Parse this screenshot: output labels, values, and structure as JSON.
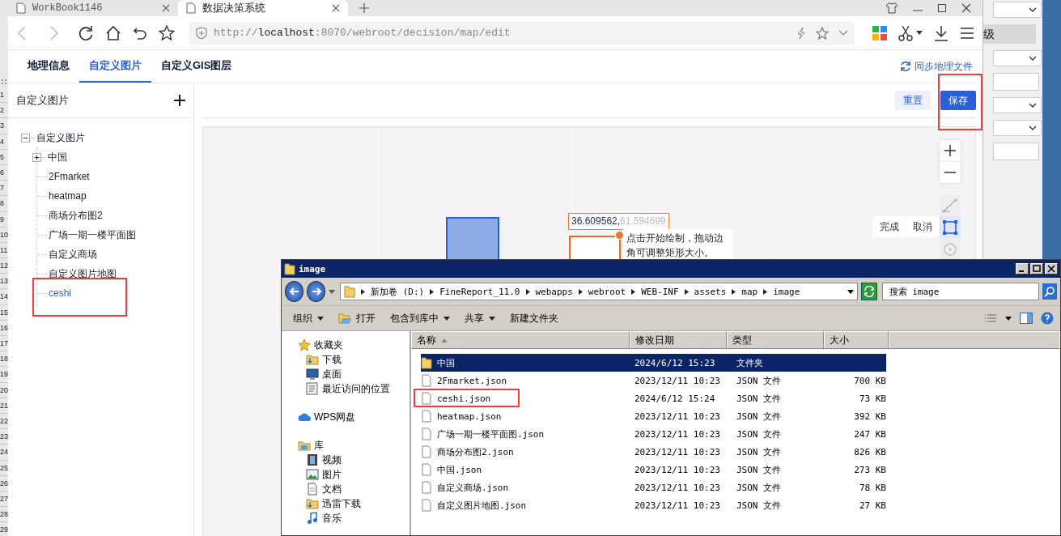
{
  "spreadsheet_background": {
    "row_numbers": [
      "1",
      "2",
      "3",
      "4",
      "5",
      "6",
      "7",
      "8",
      "9",
      "10",
      "11",
      "12",
      "13",
      "14",
      "15",
      "16",
      "17",
      "18",
      "19",
      "20",
      "21",
      "22",
      "23",
      "24",
      "25",
      "26",
      "27",
      "28",
      "29"
    ],
    "panel_label": "级"
  },
  "browser": {
    "tabs": [
      {
        "title": "WorkBook1146",
        "selected": false
      },
      {
        "title": "数据决策系统",
        "selected": true
      }
    ],
    "address": "http://**localhost**:8070/webroot/decision/map/edit",
    "app": {
      "tabs": [
        {
          "label": "地理信息",
          "selected": false
        },
        {
          "label": "自定义图片",
          "selected": true
        },
        {
          "label": "自定义GIS图层",
          "selected": false
        }
      ],
      "sync_link": "同步地理文件",
      "sidebar": {
        "title": "自定义图片",
        "tree": [
          {
            "label": "自定义图片",
            "expanded": true,
            "selected": false,
            "children": [
              {
                "label": "中国",
                "expanded": false,
                "selected": false
              },
              {
                "label": "2Fmarket",
                "selected": false
              },
              {
                "label": "heatmap",
                "selected": false
              },
              {
                "label": "商场分布图2",
                "selected": false
              },
              {
                "label": "广场一期一楼平面图",
                "selected": false
              },
              {
                "label": "自定义商场",
                "selected": false
              },
              {
                "label": "自定义图片地图",
                "selected": false
              },
              {
                "label": "ceshi",
                "selected": true
              }
            ]
          }
        ]
      },
      "buttons": [
        {
          "label": "重置",
          "kind": "secondary"
        },
        {
          "label": "保存",
          "kind": "primary"
        }
      ],
      "canvas": {
        "coordinate": "36.609562,",
        "coordinate_preview": "61.594699",
        "tooltip": "点击开始绘制，拖动边角可调整矩形大小。",
        "draw_actions": [
          "完成",
          "取消"
        ],
        "tools": [
          {
            "kind": "line",
            "selected": false
          },
          {
            "kind": "rectangle",
            "selected": true
          },
          {
            "kind": "circle",
            "selected": false
          }
        ]
      }
    }
  },
  "explorer": {
    "title": "image",
    "path": [
      "新加卷 (D:)",
      "FineReport_11.0",
      "webapps",
      "webroot",
      "WEB-INF",
      "assets",
      "map",
      "image"
    ],
    "search": {
      "placeholder": "搜索 image"
    },
    "toolbar": [
      {
        "label": "组织",
        "kind": "menu"
      },
      {
        "label": "打开",
        "kind": "open"
      },
      {
        "label": "包含到库中",
        "kind": "menu"
      },
      {
        "label": "共享",
        "kind": "menu"
      },
      {
        "label": "新建文件夹",
        "kind": "plain"
      }
    ],
    "nav": [
      {
        "label": "收藏夹",
        "kind": "star",
        "children": [
          {
            "label": "下载",
            "kind": "download"
          },
          {
            "label": "桌面",
            "kind": "desktop"
          },
          {
            "label": "最近访问的位置",
            "kind": "recent"
          }
        ]
      },
      {
        "label": "WPS网盘",
        "kind": "cloud"
      },
      {
        "label": "库",
        "kind": "library",
        "children": [
          {
            "label": "视频",
            "kind": "video"
          },
          {
            "label": "图片",
            "kind": "picture"
          },
          {
            "label": "文档",
            "kind": "document"
          },
          {
            "label": "迅雷下载",
            "kind": "download"
          },
          {
            "label": "音乐",
            "kind": "music"
          }
        ]
      }
    ],
    "columns": [
      "名称",
      "修改日期",
      "类型",
      "大小"
    ],
    "files": [
      {
        "name": "中国",
        "modified": "2024/6/12 15:23",
        "type": "文件夹",
        "kind": "folder",
        "selected": true
      },
      {
        "name": "2Fmarket.json",
        "modified": "2023/12/11 10:23",
        "type": "JSON 文件",
        "size": "700 KB",
        "kind": "file",
        "selected": false
      },
      {
        "name": "ceshi.json",
        "modified": "2024/6/12 15:24",
        "type": "JSON 文件",
        "size": "73 KB",
        "kind": "file",
        "selected": false
      },
      {
        "name": "heatmap.json",
        "modified": "2023/12/11 10:23",
        "type": "JSON 文件",
        "size": "392 KB",
        "kind": "file",
        "selected": false
      },
      {
        "name": "广场一期一楼平面图.json",
        "modified": "2023/12/11 10:23",
        "type": "JSON 文件",
        "size": "247 KB",
        "kind": "file",
        "selected": false
      },
      {
        "name": "商场分布图2.json",
        "modified": "2023/12/11 10:23",
        "type": "JSON 文件",
        "size": "826 KB",
        "kind": "file",
        "selected": false
      },
      {
        "name": "中国.json",
        "modified": "2023/12/11 10:23",
        "type": "JSON 文件",
        "size": "273 KB",
        "kind": "file",
        "selected": false
      },
      {
        "name": "自定义商场.json",
        "modified": "2023/12/11 10:23",
        "type": "JSON 文件",
        "size": "78 KB",
        "kind": "file",
        "selected": false
      },
      {
        "name": "自定义图片地图.json",
        "modified": "2023/12/11 10:23",
        "type": "JSON 文件",
        "size": "27 KB",
        "kind": "file",
        "selected": false
      }
    ]
  }
}
